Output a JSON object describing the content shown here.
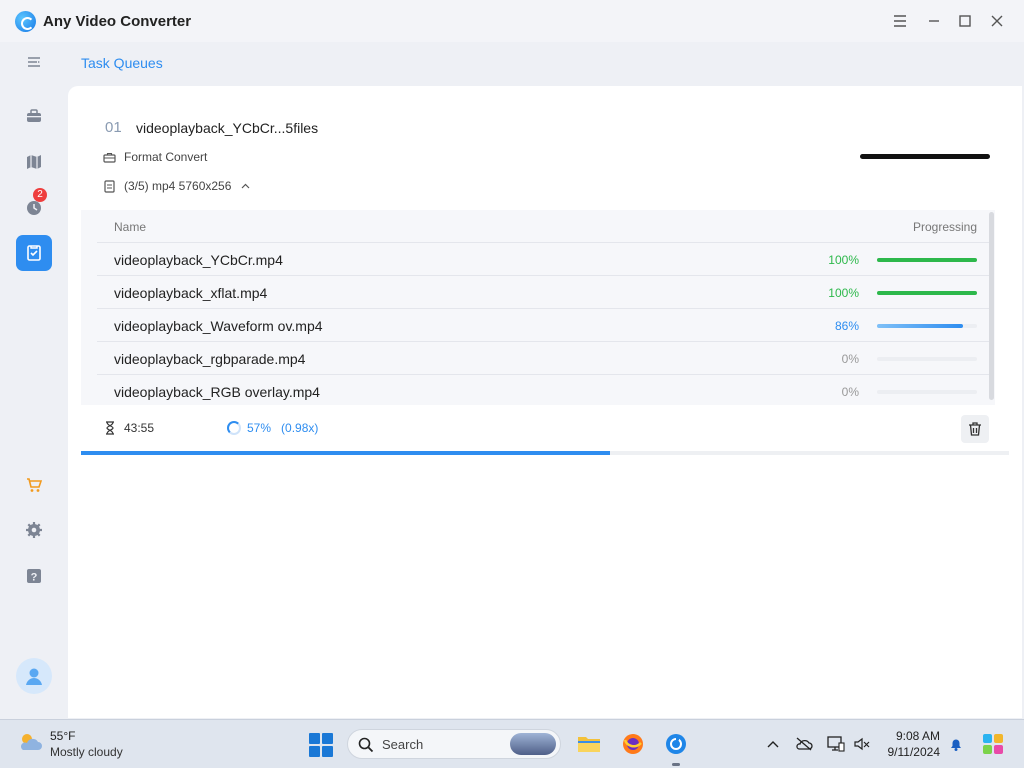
{
  "window": {
    "title": "Any Video Converter"
  },
  "page": {
    "heading": "Task Queues"
  },
  "sidebar": {
    "history_badge": "2"
  },
  "task": {
    "number": "01",
    "name": "videoplayback_YCbCr...5files",
    "type_label": "Format Convert",
    "details": "(3/5) mp4 5760x256"
  },
  "table": {
    "col_name": "Name",
    "col_progress": "Progressing",
    "rows": [
      {
        "name": "videoplayback_YCbCr.mp4",
        "percent": "100%",
        "progress": 1.0,
        "color": "#2db84b"
      },
      {
        "name": "videoplayback_xflat.mp4",
        "percent": "100%",
        "progress": 1.0,
        "color": "#2db84b"
      },
      {
        "name": "videoplayback_Waveform ov.mp4",
        "percent": "86%",
        "progress": 0.86,
        "color": "#2e8df0"
      },
      {
        "name": "videoplayback_rgbparade.mp4",
        "percent": "0%",
        "progress": 0.0,
        "color": "#999999"
      },
      {
        "name": "videoplayback_RGB overlay.mp4",
        "percent": "0%",
        "progress": 0.0,
        "color": "#999999"
      }
    ]
  },
  "footer": {
    "elapsed": "43:55",
    "overall_percent": "57%",
    "speed": "(0.98x)",
    "overall_progress": 0.57
  },
  "taskbar": {
    "weather_temp": "55°F",
    "weather_desc": "Mostly cloudy",
    "search_placeholder": "Search",
    "time": "9:08 AM",
    "date": "9/11/2024"
  },
  "colors": {
    "accent": "#2e8df0",
    "done": "#2db84b",
    "badge": "#ee3e3e"
  }
}
